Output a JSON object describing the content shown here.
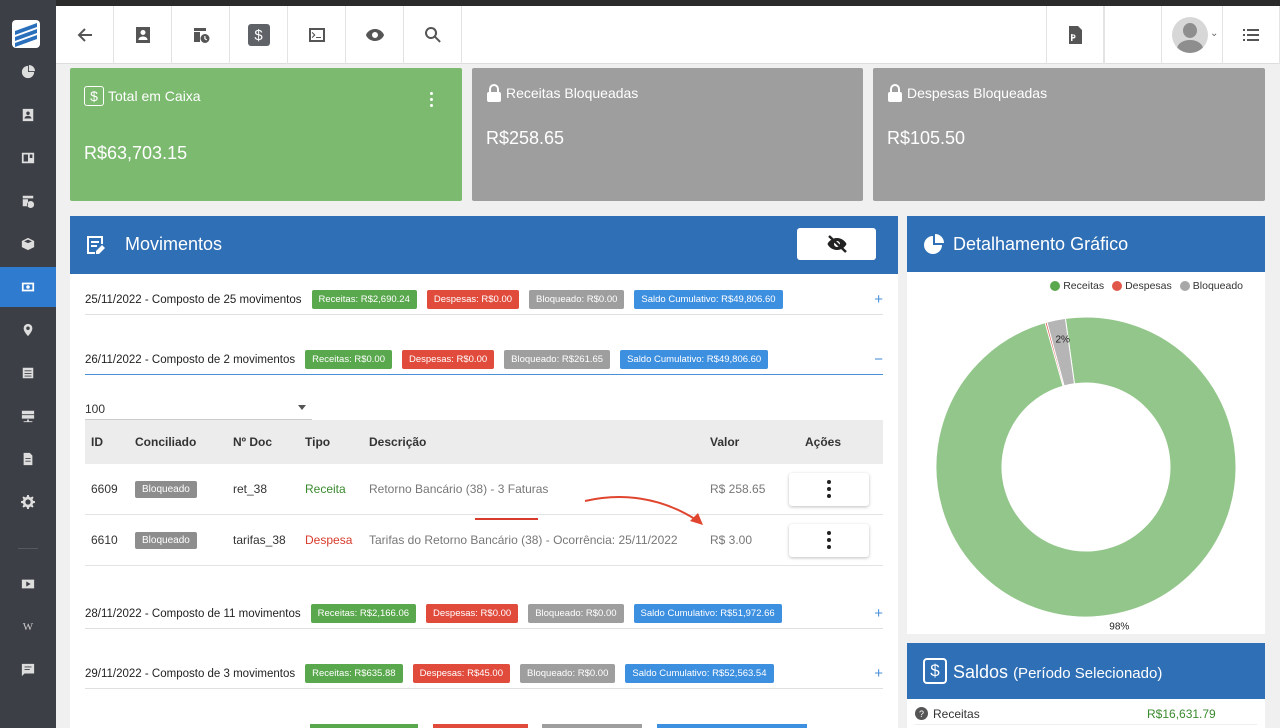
{
  "cards": {
    "caixa": {
      "title": "Total em Caixa",
      "value": "R$63,703.15"
    },
    "receitas_bloq": {
      "title": "Receitas Bloqueadas",
      "value": "R$258.65"
    },
    "despesas_bloq": {
      "title": "Despesas Bloqueadas",
      "value": "R$105.50"
    }
  },
  "movimentos": {
    "title": "Movimentos",
    "groups": [
      {
        "date_label": "25/11/2022 - Composto de 25 movimentos",
        "receitas": "Receitas: R$2,690.24",
        "despesas": "Despesas: R$0.00",
        "bloqueado": "Bloqueado: R$0.00",
        "saldo": "Saldo Cumulativo: R$49,806.60",
        "toggle": "+"
      },
      {
        "date_label": "26/11/2022 - Composto de 2 movimentos",
        "receitas": "Receitas: R$0.00",
        "despesas": "Despesas: R$0.00",
        "bloqueado": "Bloqueado: R$261.65",
        "saldo": "Saldo Cumulativo: R$49,806.60",
        "toggle": "−"
      },
      {
        "date_label": "28/11/2022 - Composto de 11 movimentos",
        "receitas": "Receitas: R$2,166.06",
        "despesas": "Despesas: R$0.00",
        "bloqueado": "Bloqueado: R$0.00",
        "saldo": "Saldo Cumulativo: R$51,972.66",
        "toggle": "+"
      },
      {
        "date_label": "29/11/2022 - Composto de 3 movimentos",
        "receitas": "Receitas: R$635.88",
        "despesas": "Despesas: R$45.00",
        "bloqueado": "Bloqueado: R$0.00",
        "saldo": "Saldo Cumulativo: R$52,563.54",
        "toggle": "+"
      }
    ],
    "page_size": "100",
    "columns": {
      "id": "ID",
      "conciliado": "Conciliado",
      "doc": "Nº Doc",
      "tipo": "Tipo",
      "descricao": "Descrição",
      "valor": "Valor",
      "acoes": "Ações"
    },
    "rows": [
      {
        "id": "6609",
        "conciliado": "Bloqueado",
        "doc": "ret_38",
        "tipo": "Receita",
        "descricao": "Retorno Bancário (38) - 3 Faturas",
        "valor": "R$ 258.65"
      },
      {
        "id": "6610",
        "conciliado": "Bloqueado",
        "doc": "tarifas_38",
        "tipo": "Despesa",
        "descricao": "Tarifas do Retorno Bancário (38) - Ocorrência: 25/11/2022",
        "valor": "R$ 3.00"
      }
    ]
  },
  "grafico": {
    "title": "Detalhamento Gráfico",
    "legend": [
      "Receitas",
      "Despesas",
      "Bloqueado"
    ]
  },
  "chart_data": {
    "type": "pie",
    "donut": true,
    "categories": [
      "Receitas",
      "Despesas",
      "Bloqueado"
    ],
    "values": [
      98,
      0.2,
      2
    ],
    "data_labels": [
      "98%",
      "",
      "2%"
    ],
    "colors": [
      "#93c68a",
      "#e0574a",
      "#b5b5b5"
    ]
  },
  "saldos": {
    "title": "Saldos",
    "subtitle": "(Período Selecionado)",
    "rows": [
      {
        "label": "Receitas",
        "value": "R$16,631.79"
      }
    ]
  },
  "colors": {
    "brand_blue": "#2f6fb5",
    "green": "#7cba6f",
    "gray": "#9e9e9e"
  }
}
